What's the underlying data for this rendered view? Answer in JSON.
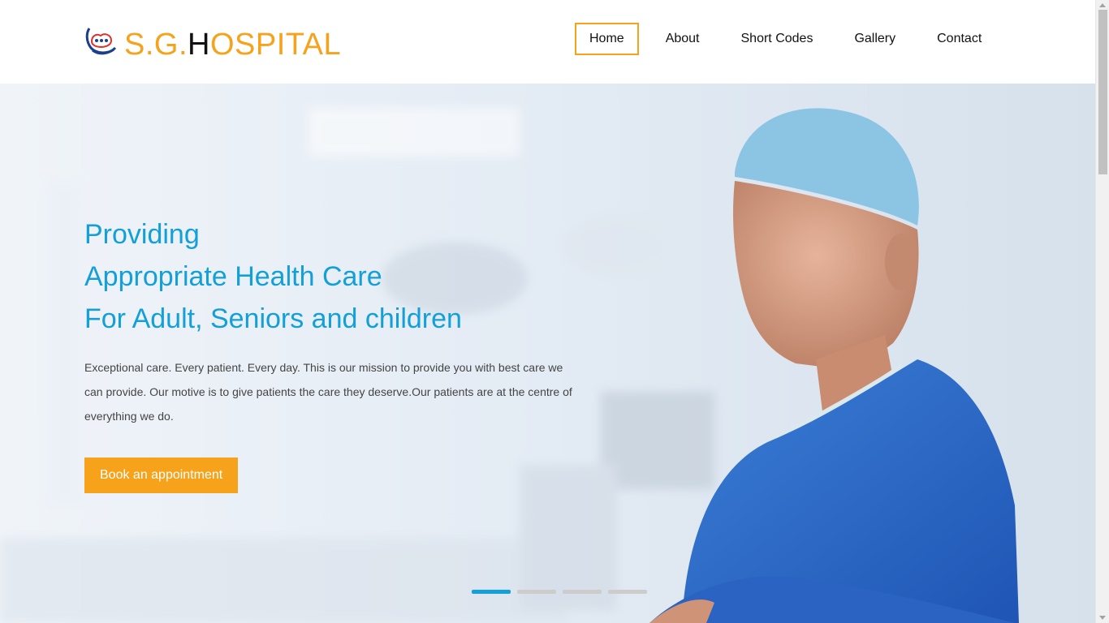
{
  "brand": {
    "prefix": "S.G.",
    "h": "H",
    "suffix": "OSPITAL",
    "accent_color": "#f7a21b",
    "logo_icon": "hospital-logo-icon"
  },
  "nav": {
    "items": [
      {
        "label": "Home",
        "active": true
      },
      {
        "label": "About",
        "active": false
      },
      {
        "label": "Short Codes",
        "active": false
      },
      {
        "label": "Gallery",
        "active": false
      },
      {
        "label": "Contact",
        "active": false
      }
    ]
  },
  "hero": {
    "title_lines": [
      "Providing",
      "Appropriate Health Care",
      "For Adult, Seniors and children"
    ],
    "description": "Exceptional care. Every patient. Every day. This is our mission to provide you with best care we can provide. Our motive is to give patients the care they deserve.Our patients are at the centre of everything we do.",
    "button_label": "Book an appointment",
    "title_color": "#139fd8",
    "button_color": "#f7a21b",
    "image": "doctor-in-scrubs-photo"
  },
  "slider": {
    "slides": 4,
    "active_index": 0
  }
}
